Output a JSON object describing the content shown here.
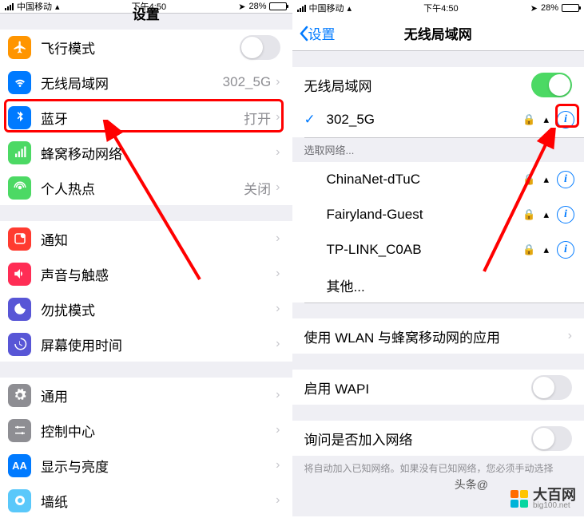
{
  "status": {
    "carrier": "中国移动",
    "time": "下午4:50",
    "battery": "28%"
  },
  "left": {
    "title": "设置",
    "g1": [
      {
        "icon": "airplane",
        "color": "#ff9500",
        "label": "飞行模式",
        "type": "toggle",
        "on": false
      },
      {
        "icon": "wifi",
        "color": "#007aff",
        "label": "无线局域网",
        "detail": "302_5G",
        "hl": true
      },
      {
        "icon": "bluetooth",
        "color": "#007aff",
        "label": "蓝牙",
        "detail": "打开"
      },
      {
        "icon": "cellular",
        "color": "#4cd964",
        "label": "蜂窝移动网络"
      },
      {
        "icon": "hotspot",
        "color": "#4cd964",
        "label": "个人热点",
        "detail": "关闭"
      }
    ],
    "g2": [
      {
        "icon": "notif",
        "color": "#ff3b30",
        "label": "通知"
      },
      {
        "icon": "sound",
        "color": "#ff2d55",
        "label": "声音与触感"
      },
      {
        "icon": "dnd",
        "color": "#5856d6",
        "label": "勿扰模式"
      },
      {
        "icon": "screentime",
        "color": "#5856d6",
        "label": "屏幕使用时间"
      }
    ],
    "g3": [
      {
        "icon": "general",
        "color": "#8e8e93",
        "label": "通用"
      },
      {
        "icon": "control",
        "color": "#8e8e93",
        "label": "控制中心"
      },
      {
        "icon": "display",
        "color": "#007aff",
        "label": "显示与亮度"
      },
      {
        "icon": "wallpaper",
        "color": "#5ac8fa",
        "label": "墙纸"
      }
    ]
  },
  "right": {
    "back": "设置",
    "title": "无线局域网",
    "wifi_label": "无线局域网",
    "connected": {
      "name": "302_5G",
      "lock": true
    },
    "choose_header": "选取网络...",
    "networks": [
      {
        "name": "ChinaNet-dTuC",
        "lock": true
      },
      {
        "name": "Fairyland-Guest",
        "lock": true
      },
      {
        "name": "TP-LINK_C0AB",
        "lock": true
      }
    ],
    "other": "其他...",
    "apps": "使用 WLAN 与蜂窝移动网的应用",
    "wapi": "启用 WAPI",
    "ask": "询问是否加入网络",
    "ask_footer": "将自动加入已知网络。如果没有已知网络，您必须手动选择"
  },
  "watermark": {
    "toutiao": "头条@",
    "main": "大百网",
    "sub": "big100.net"
  }
}
